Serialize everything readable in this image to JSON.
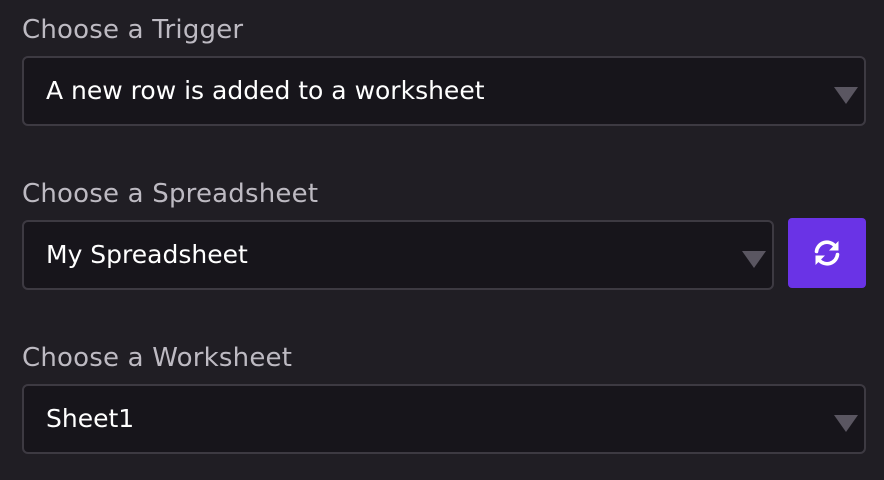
{
  "trigger": {
    "label": "Choose a Trigger",
    "value": "A new row is added to a worksheet"
  },
  "spreadsheet": {
    "label": "Choose a Spreadsheet",
    "value": "My Spreadsheet",
    "refresh_icon": "refresh-icon"
  },
  "worksheet": {
    "label": "Choose a Worksheet",
    "value": "Sheet1"
  },
  "colors": {
    "background": "#201e24",
    "field_background": "#17151b",
    "field_border": "#3d3a42",
    "label_text": "#bdbac2",
    "value_text": "#ffffff",
    "accent": "#6a33e6"
  }
}
